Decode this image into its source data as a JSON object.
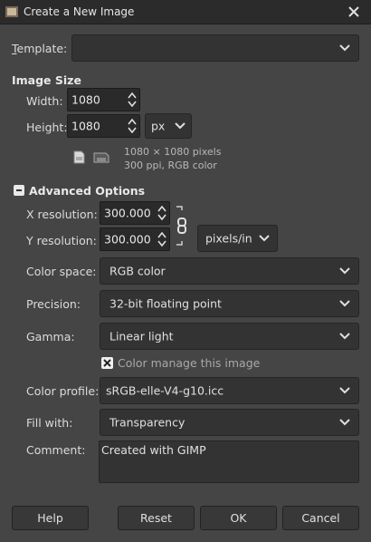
{
  "window": {
    "title": "Create a New Image"
  },
  "template": {
    "label": "Template:",
    "value": ""
  },
  "image_size": {
    "heading": "Image Size",
    "width_label": "Width:",
    "width_value": "1080",
    "height_label": "Height:",
    "height_value": "1080",
    "unit": "px",
    "info_line1": "1080 × 1080 pixels",
    "info_line2": "300 ppi, RGB color"
  },
  "advanced": {
    "heading": "Advanced Options",
    "x_res_label": "X resolution:",
    "x_res_value": "300.000",
    "y_res_label": "Y resolution:",
    "y_res_value": "300.000",
    "res_unit": "pixels/in",
    "color_space_label": "Color space:",
    "color_space_value": "RGB color",
    "precision_label": "Precision:",
    "precision_value": "32-bit floating point",
    "gamma_label": "Gamma:",
    "gamma_value": "Linear light",
    "color_manage_label": "Color manage this image",
    "color_manage_checked": true,
    "color_profile_label": "Color profile:",
    "color_profile_value": "sRGB-elle-V4-g10.icc",
    "fill_label": "Fill with:",
    "fill_value": "Transparency",
    "comment_label": "Comment:",
    "comment_value": "Created with GIMP"
  },
  "buttons": {
    "help": "Help",
    "reset": "Reset",
    "ok": "OK",
    "cancel": "Cancel"
  },
  "icons": {
    "app": "gimp-icon",
    "close": "close-icon",
    "portrait": "portrait-icon",
    "landscape": "landscape-icon",
    "chain": "chain-link-icon",
    "collapse": "collapse-icon"
  }
}
